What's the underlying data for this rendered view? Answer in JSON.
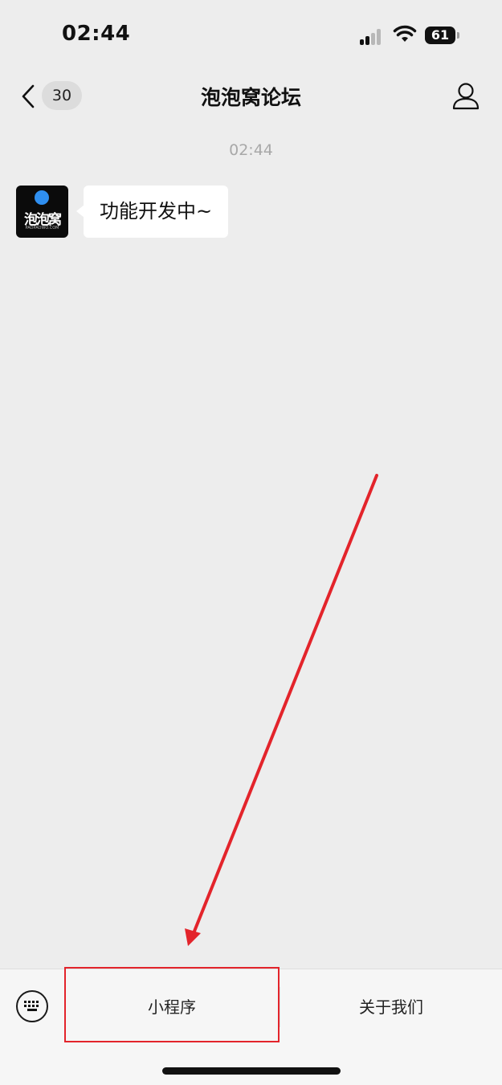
{
  "status_bar": {
    "time": "02:44",
    "battery": "61",
    "icons": [
      "signal-icon",
      "wifi-icon",
      "battery-icon"
    ]
  },
  "nav": {
    "back_icon": "chevron-left-icon",
    "unread_count": "30",
    "title": "泡泡窝论坛",
    "profile_icon": "person-icon"
  },
  "chat": {
    "timestamp": "02:44",
    "messages": [
      {
        "sender": "泡泡窝",
        "avatar_text": "泡泡窝",
        "avatar_subtext": "PAOPAOWO.COM",
        "text": "功能开发中~"
      }
    ]
  },
  "bottom_menu": {
    "keyboard_icon": "keyboard-icon",
    "items": [
      {
        "label": "小程序"
      },
      {
        "label": "关于我们"
      }
    ]
  },
  "annotation": {
    "color": "#e3242b",
    "highlight": "小程序"
  }
}
